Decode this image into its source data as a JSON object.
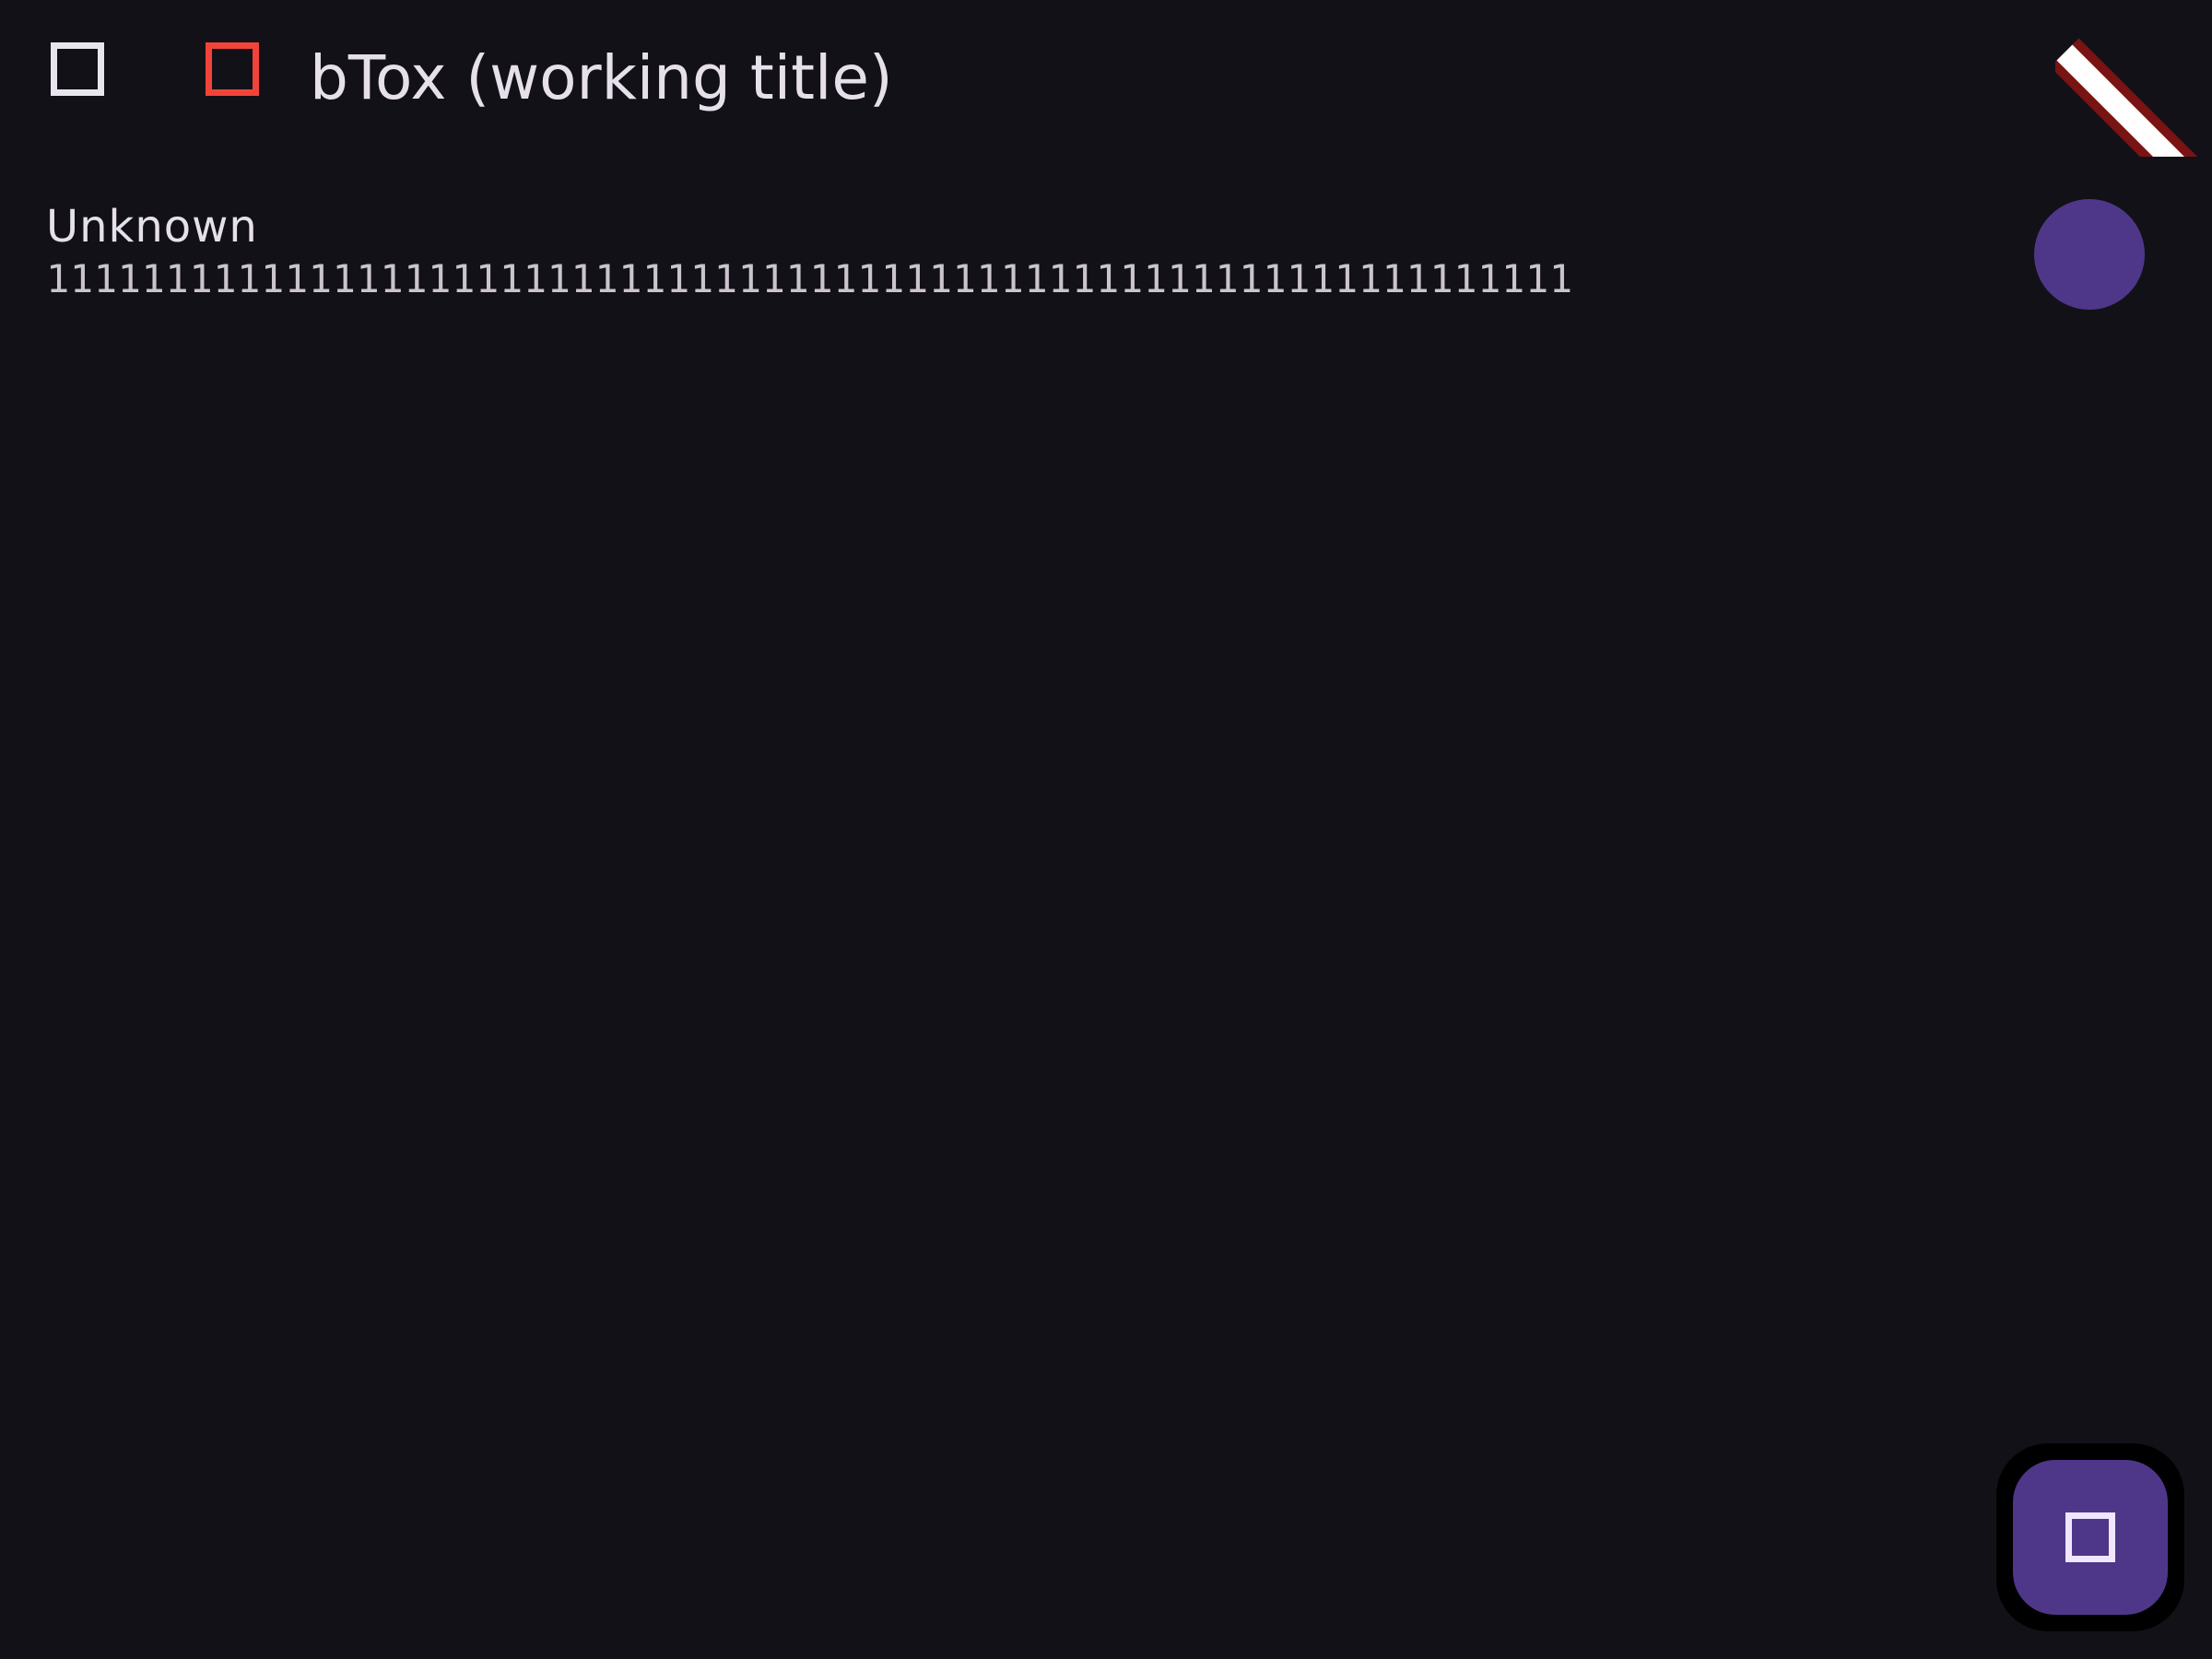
{
  "app_bar": {
    "title": "bTox (working title)",
    "menu_icon": "menu-icon",
    "status_icon": "connection-status-icon",
    "status_color": "#f0443a"
  },
  "debug_banner": {
    "colors": {
      "band": "#7a1313",
      "stripe": "#ffffff"
    }
  },
  "contacts": [
    {
      "name": "Unknown",
      "id": "1111111111111111111111111111111111111111111111111111111111111111",
      "avatar_color": "#4e3789"
    }
  ],
  "fab": {
    "icon": "add-contact-icon",
    "color": "#4e3789"
  },
  "theme": {
    "background": "#131118",
    "text_primary": "#e6e0ea",
    "text_secondary": "#cac4cf"
  }
}
